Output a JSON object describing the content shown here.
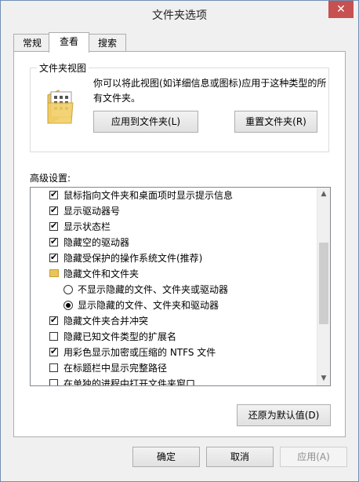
{
  "window": {
    "title": "文件夹选项",
    "close_label": "✕"
  },
  "tabs": [
    {
      "label": "常规"
    },
    {
      "label": "查看"
    },
    {
      "label": "搜索"
    }
  ],
  "folder_views": {
    "title": "文件夹视图",
    "description": "你可以将此视图(如详细信息或图标)应用于这种类型的所有文件夹。",
    "apply_button": "应用到文件夹(L)",
    "reset_button": "重置文件夹(R)"
  },
  "advanced": {
    "label": "高级设置:",
    "items": [
      {
        "type": "checkbox",
        "checked": true,
        "label": "鼠标指向文件夹和桌面项时显示提示信息"
      },
      {
        "type": "checkbox",
        "checked": true,
        "label": "显示驱动器号"
      },
      {
        "type": "checkbox",
        "checked": true,
        "label": "显示状态栏"
      },
      {
        "type": "checkbox",
        "checked": true,
        "label": "隐藏空的驱动器"
      },
      {
        "type": "checkbox",
        "checked": true,
        "label": "隐藏受保护的操作系统文件(推荐)"
      },
      {
        "type": "folder",
        "label": "隐藏文件和文件夹"
      },
      {
        "type": "radio",
        "checked": false,
        "label": "不显示隐藏的文件、文件夹或驱动器"
      },
      {
        "type": "radio",
        "checked": true,
        "label": "显示隐藏的文件、文件夹和驱动器"
      },
      {
        "type": "checkbox",
        "checked": true,
        "label": "隐藏文件夹合并冲突"
      },
      {
        "type": "checkbox",
        "checked": false,
        "label": "隐藏已知文件类型的扩展名"
      },
      {
        "type": "checkbox",
        "checked": true,
        "label": "用彩色显示加密或压缩的 NTFS 文件"
      },
      {
        "type": "checkbox",
        "checked": false,
        "label": "在标题栏中显示完整路径"
      },
      {
        "type": "checkbox",
        "checked": false,
        "label": "在单独的进程中打开文件夹窗口"
      }
    ],
    "restore_button": "还原为默认值(D)"
  },
  "footer": {
    "ok": "确定",
    "cancel": "取消",
    "apply": "应用(A)"
  },
  "colors": {
    "disabled_text": "#8d8d8d"
  }
}
